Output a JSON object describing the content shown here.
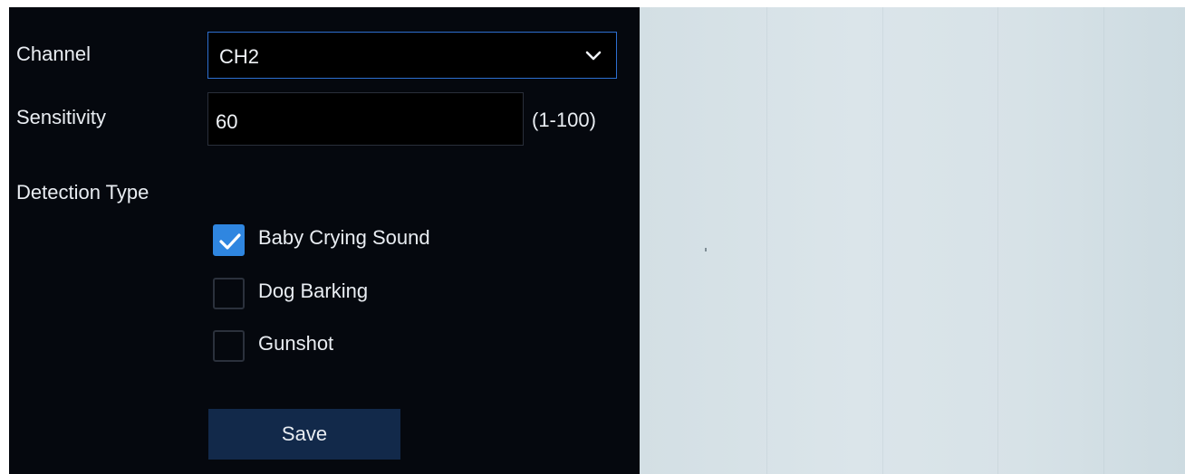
{
  "channel": {
    "label": "Channel",
    "value": "CH2"
  },
  "sensitivity": {
    "label": "Sensitivity",
    "value": "60",
    "range_hint": "(1-100)"
  },
  "detection_type": {
    "label": "Detection Type",
    "options": [
      {
        "label": "Baby Crying Sound",
        "checked": true
      },
      {
        "label": "Dog Barking",
        "checked": false
      },
      {
        "label": "Gunshot",
        "checked": false
      }
    ]
  },
  "save_label": "Save",
  "colors": {
    "panel_bg": "#05080e",
    "accent": "#2f86e0",
    "button_bg": "#12294a",
    "preview_bg": "#d7e2e7"
  },
  "icons": {
    "dropdown": "chevron-down-icon",
    "check": "checkmark-icon"
  }
}
